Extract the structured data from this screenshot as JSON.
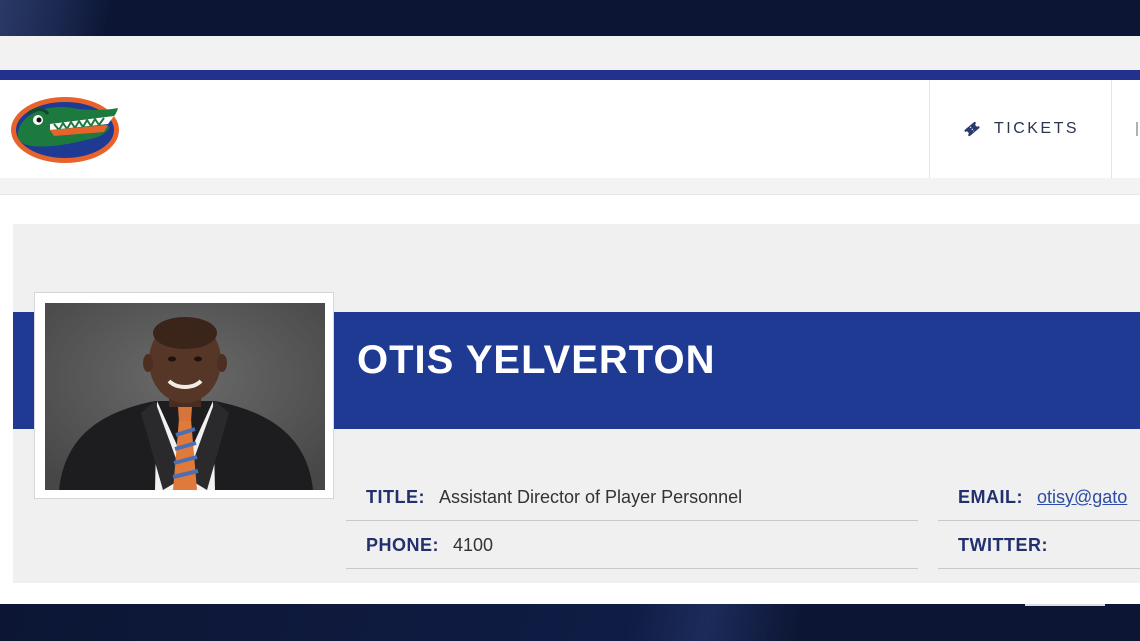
{
  "header": {
    "logo_name": "gators-logo",
    "tickets_label": "TICKETS"
  },
  "profile": {
    "name": "OTIS YELVERTON",
    "fields": {
      "title_label": "TITLE:",
      "title_value": "Assistant Director of Player Personnel",
      "phone_label": "PHONE:",
      "phone_value": "4100",
      "email_label": "EMAIL:",
      "email_value": "otisy@gato",
      "twitter_label": "TWITTER:",
      "twitter_value": ""
    }
  },
  "colors": {
    "brand_blue": "#1f3a93",
    "nav_blue": "#22328c",
    "label_blue": "#22306e",
    "gator_orange": "#e8632b",
    "gator_green": "#1c7a3e",
    "frame_dark": "#0e1a3d"
  }
}
